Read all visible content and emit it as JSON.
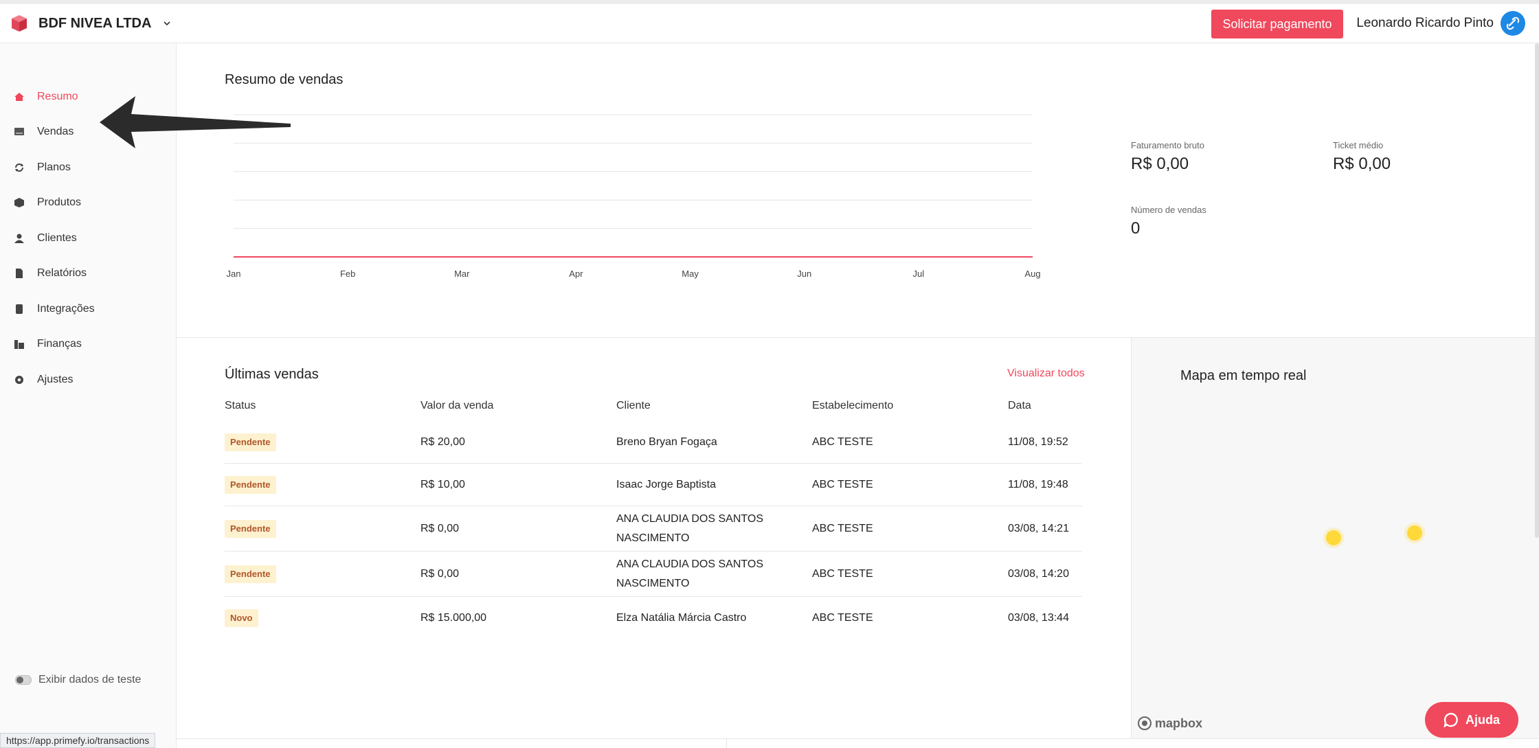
{
  "header": {
    "company": "BDF NIVEA LTDA",
    "request_payment": "Solicitar pagamento",
    "user_name": "Leonardo Ricardo Pinto"
  },
  "sidebar": {
    "items": [
      {
        "label": "Resumo",
        "icon": "home-icon",
        "active": true
      },
      {
        "label": "Vendas",
        "icon": "sales-icon"
      },
      {
        "label": "Planos",
        "icon": "refresh-icon"
      },
      {
        "label": "Produtos",
        "icon": "box-icon"
      },
      {
        "label": "Clientes",
        "icon": "user-icon"
      },
      {
        "label": "Relatórios",
        "icon": "report-icon"
      },
      {
        "label": "Integrações",
        "icon": "integration-icon"
      },
      {
        "label": "Finanças",
        "icon": "finance-icon"
      },
      {
        "label": "Ajustes",
        "icon": "gear-icon"
      }
    ],
    "test_toggle_label": "Exibir dados de teste"
  },
  "status_url": "https://app.primefy.io/transactions",
  "summary": {
    "title": "Resumo de vendas",
    "kpis": {
      "gross_label": "Faturamento bruto",
      "gross_value": "R$ 0,00",
      "ticket_label": "Ticket médio",
      "ticket_value": "R$ 0,00",
      "count_label": "Número de vendas",
      "count_value": "0"
    }
  },
  "chart_data": {
    "type": "line",
    "categories": [
      "Jan",
      "Feb",
      "Mar",
      "Apr",
      "May",
      "Jun",
      "Jul",
      "Aug"
    ],
    "series": [
      {
        "values": [
          0,
          0,
          0,
          0,
          0,
          0,
          0,
          0
        ]
      }
    ],
    "color": "#f0485c",
    "grid": true
  },
  "sales": {
    "title": "Últimas vendas",
    "view_all": "Visualizar todos",
    "headers": [
      "Status",
      "Valor da venda",
      "Cliente",
      "Estabelecimento",
      "Data"
    ],
    "rows": [
      {
        "status": "Pendente",
        "value": "R$ 20,00",
        "client": "Breno Bryan Fogaça",
        "establishment": "ABC TESTE",
        "date": "11/08, 19:52"
      },
      {
        "status": "Pendente",
        "value": "R$ 10,00",
        "client": "Isaac Jorge Baptista",
        "establishment": "ABC TESTE",
        "date": "11/08, 19:48"
      },
      {
        "status": "Pendente",
        "value": "R$ 0,00",
        "client": "ANA CLAUDIA DOS SANTOS NASCIMENTO",
        "establishment": "ABC TESTE",
        "date": "03/08, 14:21"
      },
      {
        "status": "Pendente",
        "value": "R$ 0,00",
        "client": "ANA CLAUDIA DOS SANTOS NASCIMENTO",
        "establishment": "ABC TESTE",
        "date": "03/08, 14:20"
      },
      {
        "status": "Novo",
        "value": "R$ 15.000,00",
        "client": "Elza Natália Márcia Castro",
        "establishment": "ABC TESTE",
        "date": "03/08, 13:44"
      }
    ]
  },
  "map": {
    "title": "Mapa em tempo real",
    "attribution": "mapbox",
    "help": "Ajuda"
  }
}
